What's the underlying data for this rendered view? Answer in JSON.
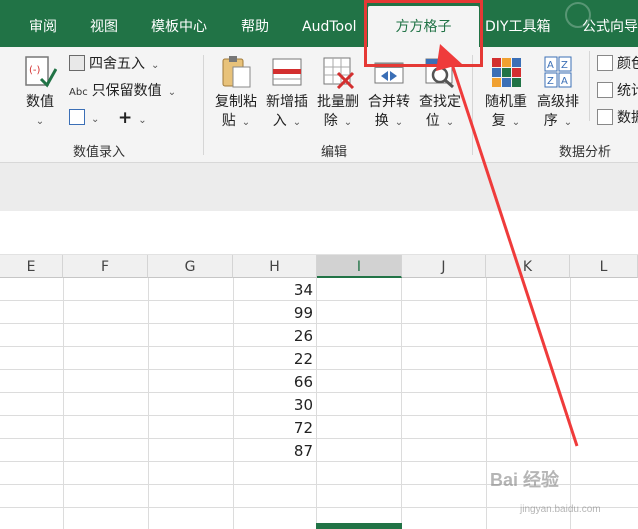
{
  "tabs": [
    {
      "label": "审阅"
    },
    {
      "label": "视图"
    },
    {
      "label": "模板中心"
    },
    {
      "label": "帮助"
    },
    {
      "label": "AudTool"
    },
    {
      "label": "方方格子"
    },
    {
      "label": "DIY工具箱"
    },
    {
      "label": "公式向导"
    }
  ],
  "active_tab": "方方格子",
  "ribbon": {
    "number_group": {
      "big_label": "数值",
      "round_label": "四舍五入",
      "keep_value_label": "只保留数值",
      "abc_text": "Abc",
      "plus_text": "+",
      "group_label": "数值录入"
    },
    "edit_group": {
      "buttons": [
        {
          "line1": "复制粘",
          "line2": "贴"
        },
        {
          "line1": "新增插",
          "line2": "入"
        },
        {
          "line1": "批量删",
          "line2": "除"
        },
        {
          "line1": "合并转",
          "line2": "换"
        },
        {
          "line1": "查找定",
          "line2": "位"
        }
      ],
      "group_label": "编辑"
    },
    "analysis_group": {
      "buttons": [
        {
          "line1": "随机重",
          "line2": "复"
        },
        {
          "line1": "高级排",
          "line2": "序"
        }
      ],
      "side_items": [
        "颜色",
        "统计",
        "数据"
      ],
      "group_label": "数据分析"
    }
  },
  "grid": {
    "columns": [
      "E",
      "F",
      "G",
      "H",
      "I",
      "J",
      "K",
      "L"
    ],
    "selected_column": "I",
    "h_values": [
      "34",
      "99",
      "26",
      "22",
      "66",
      "30",
      "72",
      "87"
    ]
  },
  "watermark": {
    "text": "Bai 经验",
    "url": "jingyan.baidu.com"
  },
  "colors": {
    "excel_green": "#217346",
    "highlight_red": "#e53935"
  }
}
